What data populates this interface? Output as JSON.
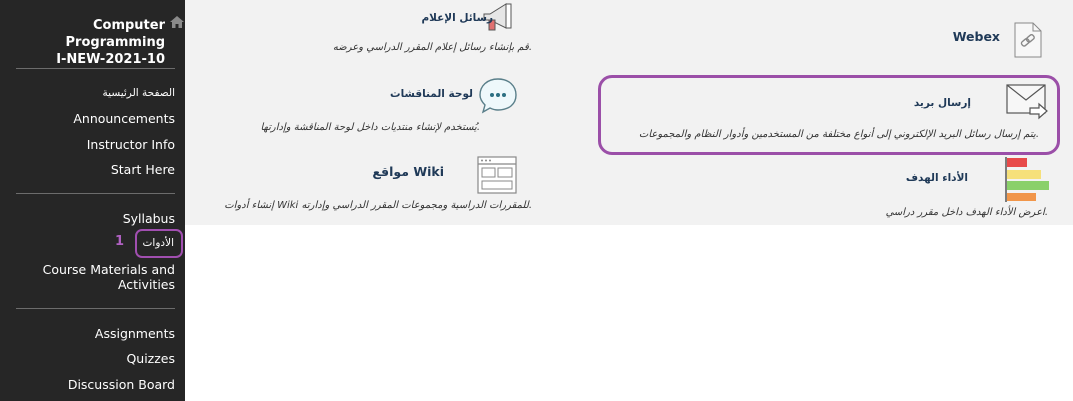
{
  "sidebar": {
    "course_title_line1": "Computer Programming",
    "course_title_line2": "I-NEW-2021-10",
    "items": [
      {
        "label": "الصفحة الرئيسية"
      },
      {
        "label": "Announcements"
      },
      {
        "label": "Instructor Info"
      },
      {
        "label": "Start Here"
      },
      {
        "label": "Syllabus"
      },
      {
        "label": "الأدوات"
      },
      {
        "label": "Course Materials and"
      },
      {
        "label": "Activities"
      },
      {
        "label": "Assignments"
      },
      {
        "label": "Quizzes"
      },
      {
        "label": "Discussion Board"
      }
    ],
    "step_number": "1",
    "colors": {
      "background": "#262626",
      "highlight": "#a14fb0"
    }
  },
  "tools": [
    {
      "title": "رسائل الإعلام",
      "description": "قم بإنشاء رسائل إعلام المقرر الدراسي وعرضه.",
      "icon": "megaphone-icon"
    },
    {
      "title": "Webex",
      "description": "",
      "icon": "document-link-icon"
    },
    {
      "title": "لوحة المناقشات",
      "description": "يُستخدم لإنشاء منتديات داخل لوحة المناقشة وإدارتها.",
      "icon": "chat-bubble-icon"
    },
    {
      "title": "إرسال بريد",
      "description": "يتم إرسال رسائل البريد الإلكتروني إلى أنواع مختلفة من المستخدمين وأدوار النظام والمجموعات.",
      "icon": "envelope-icon"
    },
    {
      "title": "مواقع Wiki",
      "description": "إنشاء أدوات Wiki للمقررات الدراسية ومجموعات المقرر الدراسي وإدارته.",
      "icon": "wiki-page-icon"
    },
    {
      "title": "الأداء الهدف",
      "description": "اعرض الأداء الهدف داخل مقرر دراسي.",
      "icon": "performance-bars-icon"
    }
  ],
  "colors": {
    "main_background": "#f2f2f2",
    "title_text": "#203a58",
    "highlight": "#9b4fa8"
  }
}
